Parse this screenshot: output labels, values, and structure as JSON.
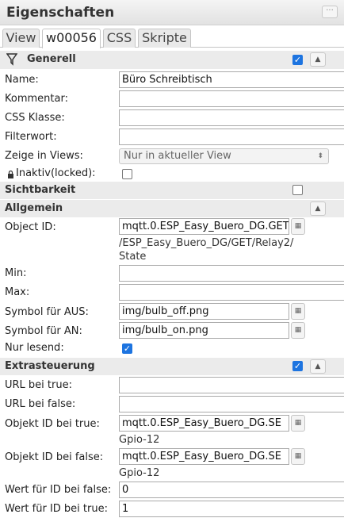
{
  "window": {
    "title": "Eigenschaften"
  },
  "tabs": [
    {
      "label": "View"
    },
    {
      "label": "w00056"
    },
    {
      "label": "CSS"
    },
    {
      "label": "Skripte"
    }
  ],
  "sections": {
    "generell": {
      "label": "Generell",
      "checked": true
    },
    "sichtbarkeit": {
      "label": "Sichtbarkeit",
      "checked": false
    },
    "allgemein": {
      "label": "Allgemein"
    },
    "extrasteuerung": {
      "label": "Extrasteuerung",
      "checked": true
    }
  },
  "fields": {
    "name": {
      "label": "Name:",
      "value": "Büro Schreibtisch"
    },
    "kommentar": {
      "label": "Kommentar:",
      "value": ""
    },
    "css_klasse": {
      "label": "CSS Klasse:",
      "value": ""
    },
    "filterwort": {
      "label": "Filterwort:",
      "value": ""
    },
    "zeige_in_views": {
      "label": "Zeige in Views:",
      "value": "Nur in aktueller View"
    },
    "inaktiv": {
      "label": "Inaktiv(locked):",
      "checked": false
    },
    "object_id": {
      "label": "Object ID:",
      "value": "mqtt.0.ESP_Easy_Buero_DG.GET",
      "sub_line1": "/ESP_Easy_Buero_DG/GET/Relay2/",
      "sub_line2": "State"
    },
    "min": {
      "label": "Min:",
      "value": ""
    },
    "max": {
      "label": "Max:",
      "value": ""
    },
    "symbol_aus": {
      "label": "Symbol für AUS:",
      "value": "img/bulb_off.png"
    },
    "symbol_an": {
      "label": "Symbol für AN:",
      "value": "img/bulb_on.png"
    },
    "nur_lesend": {
      "label": "Nur lesend:",
      "checked": true
    },
    "url_true": {
      "label": "URL bei true:",
      "value": ""
    },
    "url_false": {
      "label": "URL bei false:",
      "value": ""
    },
    "objekt_id_true": {
      "label": "Objekt ID bei true:",
      "value": "mqtt.0.ESP_Easy_Buero_DG.SE",
      "sub": "Gpio-12"
    },
    "objekt_id_false": {
      "label": "Objekt ID bei false:",
      "value": "mqtt.0.ESP_Easy_Buero_DG.SE",
      "sub": "Gpio-12"
    },
    "wert_false": {
      "label": "Wert für ID bei false:",
      "value": "0"
    },
    "wert_true": {
      "label": "Wert für ID bei true:",
      "value": "1"
    }
  }
}
